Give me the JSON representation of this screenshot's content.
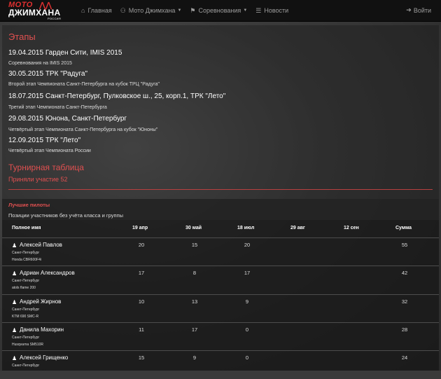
{
  "nav": {
    "logo_top": "МОТО",
    "logo_main": "ДЖИМХАНА",
    "logo_sub": "РОССИЯ",
    "items": [
      {
        "label": "Главная",
        "icon": "home-icon",
        "dropdown": false
      },
      {
        "label": "Мото Джимхана",
        "icon": "motorcycle-icon",
        "dropdown": true
      },
      {
        "label": "Соревнования",
        "icon": "flag-icon",
        "dropdown": true
      },
      {
        "label": "Новости",
        "icon": "list-icon",
        "dropdown": false
      }
    ],
    "login": "Войти"
  },
  "stages": {
    "heading": "Этапы",
    "items": [
      {
        "title": "19.04.2015 Гарден Сити, IMIS 2015",
        "desc": "Соревнования на IMIS 2015"
      },
      {
        "title": "30.05.2015 ТРК \"Радуга\"",
        "desc": "Второй этап Чемпионата Санкт-Петербурга на кубок ТРЦ \"Радуга\""
      },
      {
        "title": "18.07.2015 Санкт-Петербург, Пулковское ш., 25, корп.1, ТРК \"Лето\"",
        "desc": "Третий этап Чемпионата Санкт-Петербурга"
      },
      {
        "title": "29.08.2015 Юнона, Санкт-Петербург",
        "desc": "Четвёртый этап Чемпионата Санкт-Петербурга на кубок \"Юноны\""
      },
      {
        "title": "12.09.2015 ТРК \"Лето\"",
        "desc": "Четвёртый этап Чемпионата России"
      }
    ]
  },
  "standings": {
    "heading": "Турнирная таблица",
    "participants": "Приняли участие 52",
    "panel_title": "Лучшие пилоты",
    "panel_subtitle": "Позиции участников без учёта класса и группы",
    "columns": [
      "Полное имя",
      "19 апр",
      "30 май",
      "18 июл",
      "29 авг",
      "12 сен",
      "Сумма"
    ],
    "rows": [
      {
        "name": "Алексей Павлов",
        "city": "Санкт-Петербург",
        "bike": "Honda CBR600F4i",
        "scores": [
          "20",
          "15",
          "20",
          "",
          ""
        ],
        "total": "55"
      },
      {
        "name": "Адриан Александров",
        "city": "Санкт-Петербург",
        "bike": "atols flame 200",
        "scores": [
          "17",
          "8",
          "17",
          "",
          ""
        ],
        "total": "42"
      },
      {
        "name": "Андрей Жирнов",
        "city": "Санкт-Петербург",
        "bike": "KTM 690 SMC-R",
        "scores": [
          "10",
          "13",
          "9",
          "",
          ""
        ],
        "total": "32"
      },
      {
        "name": "Данила Махорин",
        "city": "Санкт-Петербург",
        "bike": "Husqvarna SM510R",
        "scores": [
          "11",
          "17",
          "0",
          "",
          ""
        ],
        "total": "28"
      },
      {
        "name": "Алексей Грищенко",
        "city": "Санкт-Петербург",
        "bike": "",
        "scores": [
          "15",
          "9",
          "0",
          "",
          ""
        ],
        "total": "24"
      }
    ]
  }
}
